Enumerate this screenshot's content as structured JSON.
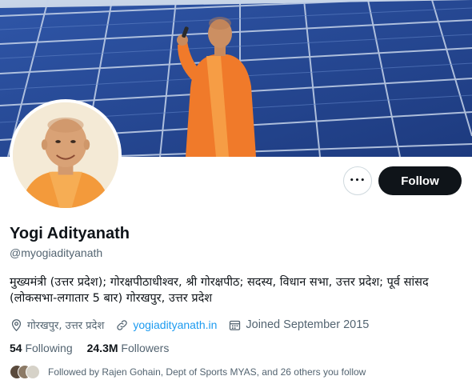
{
  "profile": {
    "name": "Yogi Adityanath",
    "handle": "@myogiadityanath",
    "bio": "मुख्यमंत्री (उत्तर प्रदेश); गोरक्षपीठाधीश्वर, श्री गोरक्षपीठ; सदस्य, विधान सभा, उत्तर प्रदेश; पूर्व सांसद (लोकसभा-लगातार 5 बार) गोरखपुर, उत्तर प्रदेश"
  },
  "actions": {
    "more_label": "•••",
    "follow_label": "Follow"
  },
  "meta": {
    "location": "गोरखपुर, उत्तर प्रदेश",
    "website": "yogiadityanath.in",
    "joined": "Joined September 2015"
  },
  "stats": {
    "following_count": "54",
    "following_label": "Following",
    "followers_count": "24.3M",
    "followers_label": "Followers"
  },
  "followed_by": {
    "text": "Followed by Rajen Gohain, Dept of Sports MYAS, and 26 others you follow"
  },
  "colors": {
    "follow_bg": "#0f1419",
    "link": "#1d9bf0",
    "secondary_text": "#536471",
    "saffron": "#f07a2a"
  },
  "icons": [
    "more-icon",
    "location-icon",
    "link-icon",
    "calendar-icon"
  ]
}
